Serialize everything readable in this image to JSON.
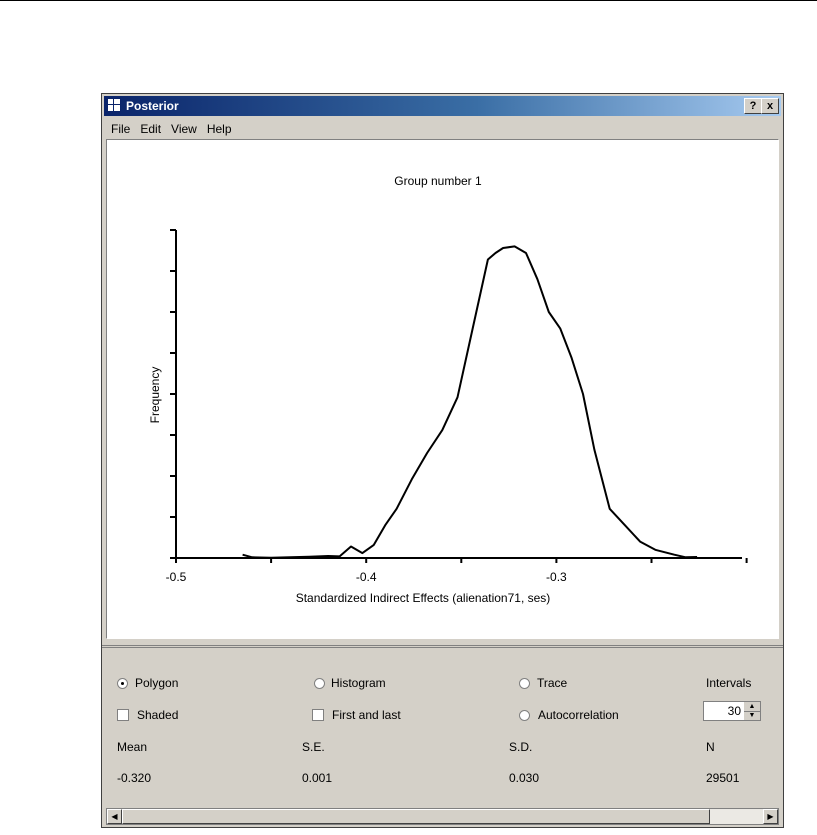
{
  "window": {
    "title": "Posterior",
    "help_btn": "?",
    "close_btn": "x"
  },
  "menu": [
    "File",
    "Edit",
    "View",
    "Help"
  ],
  "chart_data": {
    "type": "line",
    "title": "Group number 1",
    "xlabel": "Standardized Indirect Effects (alienation71, ses)",
    "ylabel": "Frequency",
    "xlim": [
      -0.5,
      -0.2
    ],
    "x_ticks": [
      -0.5,
      -0.4,
      -0.3
    ],
    "x_tick_labels": [
      "-0.5",
      "-0.4",
      "-0.3"
    ],
    "ylim": [
      0,
      1
    ],
    "series": [
      {
        "x": [
          -0.465,
          -0.46,
          -0.45,
          -0.44,
          -0.43,
          -0.42,
          -0.414,
          -0.408,
          -0.402,
          -0.396,
          -0.39,
          -0.384,
          -0.376,
          -0.368,
          -0.36,
          -0.352,
          -0.344,
          -0.336,
          -0.332,
          -0.328,
          -0.322,
          -0.316,
          -0.31,
          -0.304,
          -0.298,
          -0.292,
          -0.286,
          -0.28,
          -0.272,
          -0.264,
          -0.256,
          -0.248,
          -0.238,
          -0.232,
          -0.226
        ],
        "y": [
          0.01,
          0.002,
          0.001,
          0.002,
          0.004,
          0.006,
          0.005,
          0.035,
          0.015,
          0.04,
          0.1,
          0.15,
          0.24,
          0.32,
          0.39,
          0.49,
          0.7,
          0.91,
          0.93,
          0.945,
          0.95,
          0.93,
          0.85,
          0.75,
          0.7,
          0.61,
          0.5,
          0.33,
          0.15,
          0.1,
          0.05,
          0.025,
          0.01,
          0.002,
          0.003
        ]
      }
    ]
  },
  "controls": {
    "polygon": "Polygon",
    "histogram": "Histogram",
    "trace": "Trace",
    "intervals_label": "Intervals",
    "shaded": "Shaded",
    "first_and_last": "First and last",
    "autocorrelation": "Autocorrelation",
    "intervals_value": "30",
    "selected_mode": "polygon"
  },
  "stats": {
    "headers": [
      "Mean",
      "S.E.",
      "S.D.",
      "N"
    ],
    "values": [
      "-0.320",
      "0.001",
      "0.030",
      "29501"
    ]
  }
}
